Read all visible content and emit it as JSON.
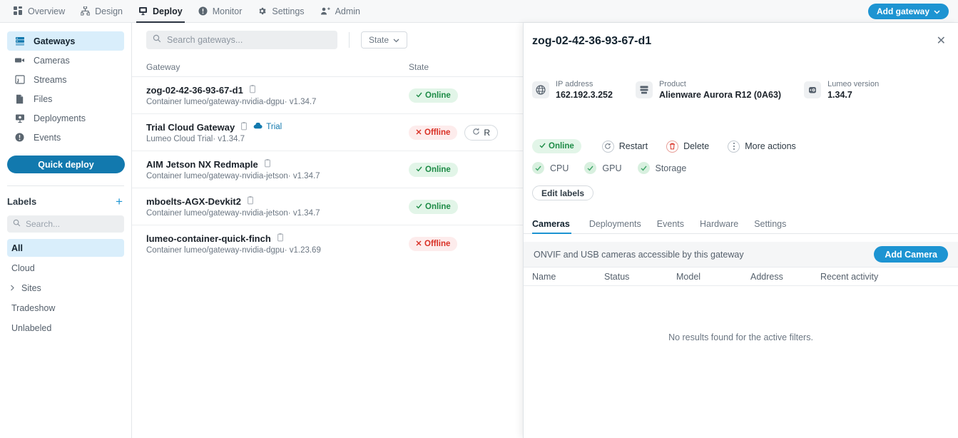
{
  "topnav": {
    "items": [
      {
        "label": "Overview",
        "icon": "grid-icon",
        "active": false
      },
      {
        "label": "Design",
        "icon": "sitemap-icon",
        "active": false
      },
      {
        "label": "Deploy",
        "icon": "monitor-deploy-icon",
        "active": true
      },
      {
        "label": "Monitor",
        "icon": "alert-circle-icon",
        "active": false
      },
      {
        "label": "Settings",
        "icon": "gear-icon",
        "active": false
      },
      {
        "label": "Admin",
        "icon": "user-add-icon",
        "active": false
      }
    ],
    "add_gateway_label": "Add gateway",
    "accent": "#1d94d2"
  },
  "sidebar": {
    "items": [
      {
        "label": "Gateways",
        "icon": "gateway-icon",
        "active": true
      },
      {
        "label": "Cameras",
        "icon": "camera-icon",
        "active": false
      },
      {
        "label": "Streams",
        "icon": "stream-icon",
        "active": false
      },
      {
        "label": "Files",
        "icon": "file-icon",
        "active": false
      },
      {
        "label": "Deployments",
        "icon": "deployment-icon",
        "active": false
      },
      {
        "label": "Events",
        "icon": "alert-circle-icon",
        "active": false
      }
    ],
    "quick_deploy_label": "Quick deploy",
    "labels_title": "Labels",
    "labels_add_glyph": "+",
    "search_placeholder": "Search...",
    "search_value": "",
    "label_items": [
      {
        "label": "All",
        "active": true,
        "expandable": false
      },
      {
        "label": "Cloud",
        "active": false,
        "expandable": false
      },
      {
        "label": "Sites",
        "active": false,
        "expandable": true
      },
      {
        "label": "Tradeshow",
        "active": false,
        "expandable": false
      },
      {
        "label": "Unlabeled",
        "active": false,
        "expandable": false
      }
    ]
  },
  "list": {
    "search_placeholder": "Search gateways...",
    "search_value": "",
    "state_filter_label": "State",
    "columns": {
      "gateway": "Gateway",
      "state": "State"
    },
    "rows": [
      {
        "name": "zog-02-42-36-93-67-d1",
        "subtitle": "Container lumeo/gateway-nvidia-dgpu· v1.34.7",
        "state": "Online",
        "state_kind": "online",
        "trial": false,
        "restart_label": ""
      },
      {
        "name": "Trial Cloud Gateway",
        "subtitle": "Lumeo Cloud Trial· v1.34.7",
        "state": "Offline",
        "state_kind": "offline",
        "trial": true,
        "trial_label": "Trial",
        "restart_label": "R"
      },
      {
        "name": "AIM Jetson NX Redmaple",
        "subtitle": "Container lumeo/gateway-nvidia-jetson· v1.34.7",
        "state": "Online",
        "state_kind": "online",
        "trial": false,
        "restart_label": ""
      },
      {
        "name": "mboelts-AGX-Devkit2",
        "subtitle": "Container lumeo/gateway-nvidia-jetson· v1.34.7",
        "state": "Online",
        "state_kind": "online",
        "trial": false,
        "restart_label": ""
      },
      {
        "name": "lumeo-container-quick-finch",
        "subtitle": "Container lumeo/gateway-nvidia-dgpu· v1.23.69",
        "state": "Offline",
        "state_kind": "offline",
        "trial": false,
        "restart_label": ""
      }
    ]
  },
  "panel": {
    "title": "zog-02-42-36-93-67-d1",
    "close_glyph": "✕",
    "meta": [
      {
        "icon": "globe-icon",
        "label": "IP address",
        "value": "162.192.3.252"
      },
      {
        "icon": "server-icon",
        "label": "Product",
        "value": "Alienware Aurora R12 (0A63)"
      },
      {
        "icon": "chip-icon",
        "label": "Lumeo version",
        "value": "1.34.7"
      }
    ],
    "status_pill": "Online",
    "actions": [
      {
        "label": "Restart",
        "icon": "refresh-icon",
        "danger": false
      },
      {
        "label": "Delete",
        "icon": "trash-icon",
        "danger": true
      },
      {
        "label": "More actions",
        "icon": "dots-vertical-icon",
        "danger": false
      }
    ],
    "health": [
      {
        "label": "CPU",
        "icon": "check-icon"
      },
      {
        "label": "GPU",
        "icon": "check-icon"
      },
      {
        "label": "Storage",
        "icon": "check-icon"
      }
    ],
    "edit_labels_label": "Edit labels",
    "tabs": [
      {
        "label": "Cameras",
        "active": true
      },
      {
        "label": "Deployments",
        "active": false
      },
      {
        "label": "Events",
        "active": false
      },
      {
        "label": "Hardware",
        "active": false
      },
      {
        "label": "Settings",
        "active": false
      }
    ],
    "cameras": {
      "banner_text": "ONVIF and USB cameras accessible by this gateway",
      "add_camera_label": "Add Camera",
      "columns": [
        "Name",
        "Status",
        "Model",
        "Address",
        "Recent activity"
      ],
      "rows": [],
      "empty_message": "No results found for the active filters."
    }
  }
}
